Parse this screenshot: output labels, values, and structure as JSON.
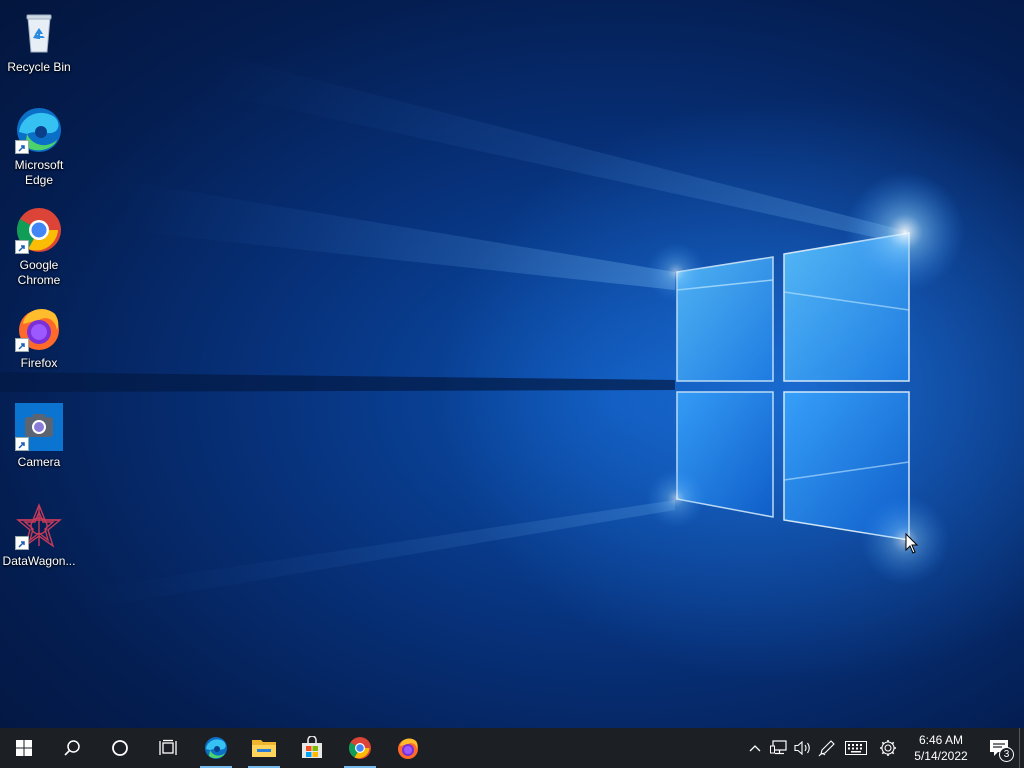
{
  "desktop": {
    "icons": [
      {
        "label": "Recycle Bin",
        "icon": "recycle-bin-icon"
      },
      {
        "label": "Microsoft Edge",
        "icon": "edge-icon"
      },
      {
        "label": "Google Chrome",
        "icon": "chrome-icon"
      },
      {
        "label": "Firefox",
        "icon": "firefox-icon"
      },
      {
        "label": "Camera",
        "icon": "camera-icon"
      },
      {
        "label": "DataWagon...",
        "icon": "datawagon-icon"
      }
    ]
  },
  "taskbar": {
    "start": "windows-logo-icon",
    "search": "search-icon",
    "cortana": "cortana-icon",
    "task_view": "task-view-icon",
    "pinned": [
      {
        "name": "Microsoft Edge",
        "icon": "edge-icon",
        "running": true
      },
      {
        "name": "File Explorer",
        "icon": "folder-icon",
        "running": true
      },
      {
        "name": "Microsoft Store",
        "icon": "store-icon",
        "running": false
      },
      {
        "name": "Google Chrome",
        "icon": "chrome-icon",
        "running": true
      },
      {
        "name": "Firefox",
        "icon": "firefox-icon",
        "running": false
      }
    ],
    "tray": [
      "chevron-up-icon",
      "network-icon",
      "volume-icon",
      "pen-icon",
      "keyboard-icon",
      "settings-icon"
    ],
    "clock": {
      "time": "6:46 AM",
      "date": "5/14/2022"
    },
    "notifications": {
      "icon": "action-center-icon",
      "count": "3"
    }
  },
  "colors": {
    "taskbar_bg": "#1c1f24",
    "running_indicator": "#76b9ed",
    "wallpaper_glow": "#3fa0ff"
  }
}
